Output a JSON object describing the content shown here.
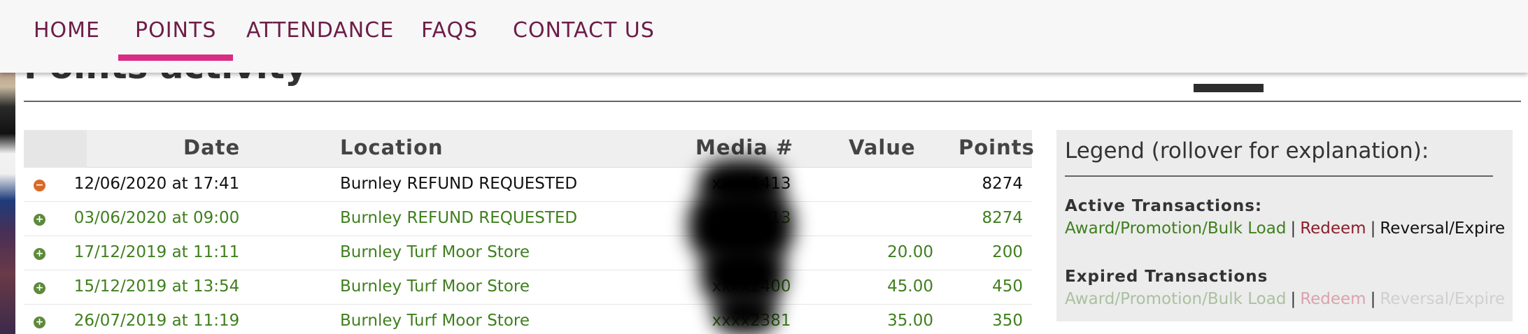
{
  "nav": {
    "items": [
      {
        "label": "HOME",
        "active": false
      },
      {
        "label": "POINTS",
        "active": true
      },
      {
        "label": "ATTENDANCE",
        "active": false
      },
      {
        "label": "FAQS",
        "active": false
      },
      {
        "label": "CONTACT US",
        "active": false
      }
    ]
  },
  "page": {
    "title": "Points activity"
  },
  "table": {
    "headers": {
      "date": "Date",
      "location": "Location",
      "media": "Media #",
      "value": "Value",
      "points": "Points"
    },
    "rows": [
      {
        "status_icon": "minus-circle-icon",
        "date": "12/06/2020 at 17:41",
        "location": "Burnley REFUND REQUESTED",
        "media": "xxxx1413",
        "value": "",
        "points": "8274"
      },
      {
        "status_icon": "plus-circle-icon",
        "date": "03/06/2020 at 09:00",
        "location": "Burnley REFUND REQUESTED",
        "media": "xxxx1413",
        "value": "",
        "points": "8274"
      },
      {
        "status_icon": "plus-circle-icon",
        "date": "17/12/2019 at 11:11",
        "location": "Burnley Turf Moor Store",
        "media": "",
        "value": "20.00",
        "points": "200"
      },
      {
        "status_icon": "plus-circle-icon",
        "date": "15/12/2019 at 13:54",
        "location": "Burnley Turf Moor Store",
        "media": "xxxx2400",
        "value": "45.00",
        "points": "450"
      },
      {
        "status_icon": "plus-circle-icon",
        "date": "26/07/2019 at 11:19",
        "location": "Burnley Turf Moor Store",
        "media": "xxxx2381",
        "value": "35.00",
        "points": "350"
      }
    ]
  },
  "legend": {
    "title": "Legend (rollover for explanation):",
    "active": {
      "heading": "Active Transactions:",
      "award": "Award/Promotion/Bulk Load",
      "separator": "|",
      "redeem": "Redeem",
      "reversal": "Reversal/Expire"
    },
    "expired": {
      "heading": "Expired Transactions",
      "award": "Award/Promotion/Bulk Load",
      "separator": "|",
      "redeem": "Redeem",
      "reversal": "Reversal/Expire"
    }
  },
  "colors": {
    "nav_text": "#6d1d48",
    "nav_active_underline": "#d92d84",
    "award_green": "#3f7f1e",
    "redeem_red": "#8b1e2d",
    "reversal_black": "#111111",
    "expired_award": "#aac0a0",
    "expired_redeem": "#d9a3ac",
    "expired_reversal": "#cfcfcf"
  }
}
